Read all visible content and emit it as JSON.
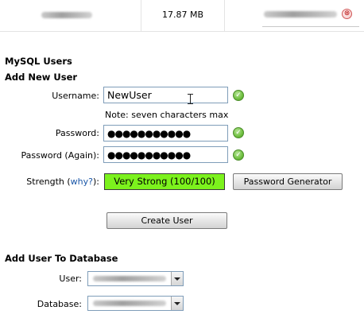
{
  "file_table": {
    "size": "17.87 MB",
    "delete_glyph": "⊗"
  },
  "section_mysql_users": "MySQL Users",
  "section_add_new_user": "Add New User",
  "form": {
    "username_label": "Username:",
    "username_value": "NewUser",
    "username_note": "Note: seven characters max",
    "password_label": "Password:",
    "password_value": "●●●●●●●●●●●",
    "password_again_label": "Password (Again):",
    "password_again_value": "●●●●●●●●●●●",
    "strength_label": "Strength",
    "strength_paren_open": "(",
    "strength_why_link": "why?",
    "strength_paren_close": "):",
    "strength_value": "Very Strong (100/100)",
    "strength_color": "#7cf21d",
    "password_generator_button": "Password Generator",
    "create_user_button": "Create User",
    "valid_check_glyph": "✓"
  },
  "section_add_user_to_db": "Add User To Database",
  "add_to_db": {
    "user_label": "User:",
    "database_label": "Database:"
  }
}
